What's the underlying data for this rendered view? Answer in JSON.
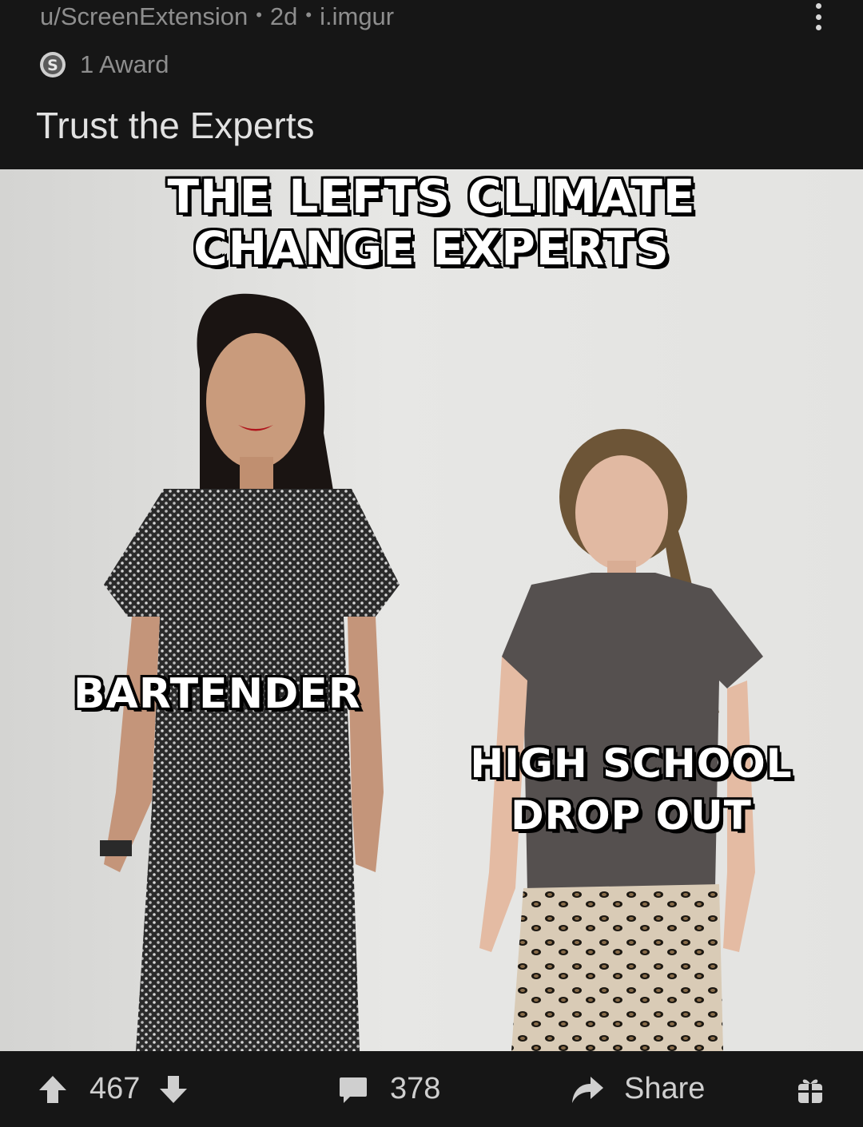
{
  "post": {
    "author": "u/ScreenExtension",
    "age": "2d",
    "domain": "i.imgur",
    "separator": "•",
    "awards_label": "1 Award",
    "title": "Trust the Experts"
  },
  "meme": {
    "top_caption_line1": "THE LEFTS CLIMATE",
    "top_caption_line2": "CHANGE EXPERTS",
    "left_caption": "BARTENDER",
    "right_caption_line1": "HIGH SCHOOL",
    "right_caption_line2": "DROP OUT"
  },
  "actions": {
    "upvotes": "467",
    "comments": "378",
    "share_label": "Share"
  },
  "icons": {
    "menu": "kebab-menu-icon",
    "award": "silver-award-icon",
    "upvote": "upvote-arrow-icon",
    "downvote": "downvote-arrow-icon",
    "comment": "comment-bubble-icon",
    "share": "share-arrow-icon",
    "gift": "gift-icon"
  },
  "colors": {
    "background": "#161616",
    "meta_text": "#8e8e8e",
    "title_text": "#e2e2e2",
    "action_text": "#cfcfcf"
  }
}
